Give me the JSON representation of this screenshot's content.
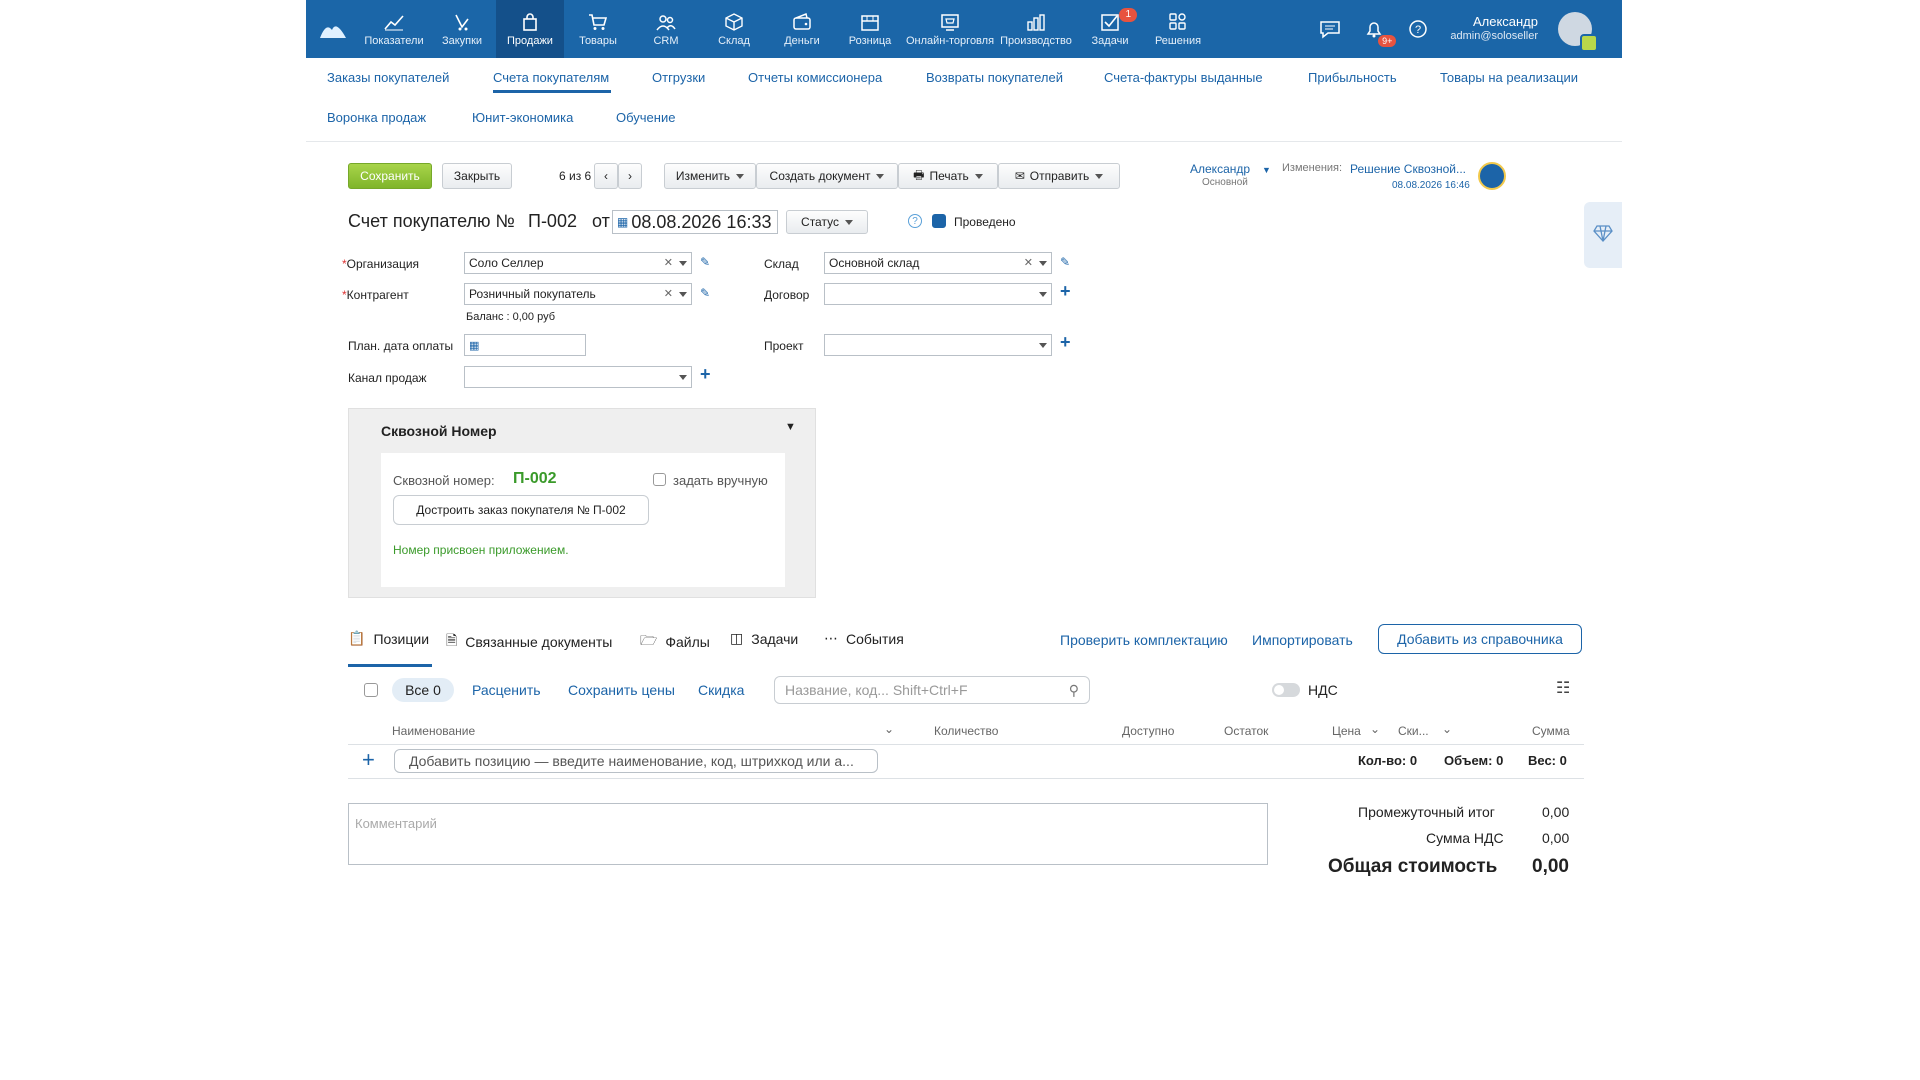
{
  "topnav": {
    "items": [
      {
        "label": "Показатели",
        "icon": "chart-line-icon"
      },
      {
        "label": "Закупки",
        "icon": "purchases-icon"
      },
      {
        "label": "Продажи",
        "icon": "bag-icon",
        "active": true
      },
      {
        "label": "Товары",
        "icon": "cart-icon"
      },
      {
        "label": "CRM",
        "icon": "people-icon"
      },
      {
        "label": "Склад",
        "icon": "box-icon"
      },
      {
        "label": "Деньги",
        "icon": "wallet-icon"
      },
      {
        "label": "Розница",
        "icon": "store-icon"
      },
      {
        "label": "Онлайн-торговля",
        "icon": "online-store-icon"
      },
      {
        "label": "Производство",
        "icon": "factory-icon"
      },
      {
        "label": "Задачи",
        "icon": "tasks-icon",
        "badge": "1"
      },
      {
        "label": "Решения",
        "icon": "apps-icon"
      }
    ],
    "bell_badge": "9+",
    "user_name": "Александр",
    "user_email": "admin@soloseller"
  },
  "subnav": {
    "row1": [
      "Заказы покупателей",
      "Счета покупателям",
      "Отгрузки",
      "Отчеты комиссионера",
      "Возвраты покупателей",
      "Счета-фактуры выданные",
      "Прибыльность",
      "Товары на реализации"
    ],
    "row2": [
      "Воронка продаж",
      "Юнит-экономика",
      "Обучение"
    ]
  },
  "toolbar": {
    "save": "Сохранить",
    "close": "Закрыть",
    "pager": "6 из 6",
    "change": "Изменить",
    "create_doc": "Создать документ",
    "print": "Печать",
    "send": "Отправить",
    "owner_name": "Александр",
    "owner_group": "Основной",
    "changes_label": "Изменения:",
    "changes_value": "Решение Сквозной...",
    "changes_date": "08.08.2026 16:46"
  },
  "doc": {
    "title_prefix": "Счет покупателю №",
    "number": "П-002",
    "from": "от",
    "date": "08.08.2026 16:33",
    "status": "Статус",
    "posted": "Проведено"
  },
  "form": {
    "org_label": "Организация",
    "org_value": "Соло Селлер",
    "contractor_label": "Контрагент",
    "contractor_value": "Розничный покупатель",
    "balance": "Баланс : 0,00 руб",
    "plan_date_label": "План. дата оплаты",
    "channel_label": "Канал продаж",
    "warehouse_label": "Склад",
    "warehouse_value": "Основной склад",
    "contract_label": "Договор",
    "project_label": "Проект"
  },
  "panel": {
    "title": "Сквозной Номер",
    "number_label": "Сквозной номер:",
    "number_value": "П-002",
    "manual_label": "задать вручную",
    "button": "Достроить заказ покупателя № П-002",
    "note": "Номер присвоен приложением."
  },
  "tabs": {
    "positions": "Позиции",
    "related": "Связанные документы",
    "files": "Файлы",
    "tasks": "Задачи",
    "events": "События",
    "check": "Проверить комплектацию",
    "import": "Импортировать",
    "add_from_catalog": "Добавить из справочника"
  },
  "table_toolbar": {
    "all": "Все 0",
    "reprice": "Расценить",
    "save_prices": "Сохранить цены",
    "discount": "Скидка",
    "search_placeholder": "Название, код... Shift+Ctrl+F",
    "vat": "НДС"
  },
  "columns": [
    "Наименование",
    "Количество",
    "Доступно",
    "Остаток",
    "Цена",
    "Ски...",
    "Сумма"
  ],
  "add_position": "Добавить позицию — введите наименование, код, штрихкод или а...",
  "summary": {
    "qty": "Кол-во: 0",
    "volume": "Объем: 0",
    "weight": "Вес: 0"
  },
  "comment_placeholder": "Комментарий",
  "totals": {
    "subtotal_label": "Промежуточный итог",
    "subtotal_value": "0,00",
    "vat_label": "Сумма НДС",
    "vat_value": "0,00",
    "total_label": "Общая стоимость",
    "total_value": "0,00"
  }
}
